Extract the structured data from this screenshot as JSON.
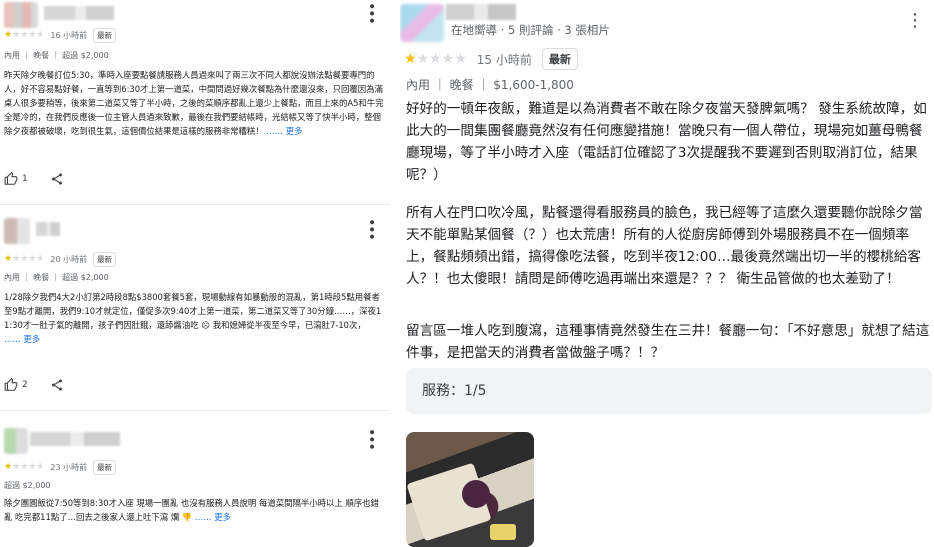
{
  "left_reviews": [
    {
      "time": "16 小時前",
      "badge": "最新",
      "sub": "內用 ｜ 晚餐 ｜ 超過 $2,000",
      "text": "昨天除夕晚餐訂位5:30，準時入座要點餐請服務人員過來叫了兩三次不同人都說沒辦法點餐要專門的人，好不容易點好餐，一直等到6:30才上第一道菜，中間問過好幾次餐點為什麼還沒來，只回覆因為滿桌人很多要稍等，後來第二道菜又等了半小時，之後的菜順序都亂上還少上餐點，而且上來的A5和牛完全是冷的，在我們反應後一位主管人員過來致歉，最後在我們要結帳時，光結帳又等了快半小時，整個除夕夜都被破壞，吃到很生氣，這個價位結果是這樣的服務非常糟糕！",
      "more": "…… 更多",
      "likes": "1"
    },
    {
      "time": "20 小時前",
      "badge": "最新",
      "sub": "內用 ｜ 晚餐 ｜ 超過 $2,000",
      "text": "1/28除夕我們4大2小訂第2時段8點$3800套餐5套，現場動線有如暴動般的混亂，第1時段5點用餐者至9點才離開，我們9:10才就定位，僅促多次9:40才上第一道菜，第二道菜又等了30分鐘……，深夜11:30才一肚子氣的離開，孩子們因肚餓，還舔醬油吃 ☹ 我和媳婦從半夜至今早，已瀉肚7-10次，",
      "more": "…… 更多",
      "likes": "2"
    },
    {
      "time": "23 小時前",
      "badge": "最新",
      "sub": "超過 $2,000",
      "text": "除夕團圓飯從7:50等到8:30才入座 現場一團亂 也沒有服務人員說明 每道菜間隔半小時以上 順序也錯亂 吃完都11點了…回去之後家人還上吐下瀉 爛 👎",
      "more": "…… 更多",
      "likes": ""
    }
  ],
  "right_review": {
    "guide": "在地嚮導 · 5 則評論 · 3 張相片",
    "time": "15 小時前",
    "badge": "最新",
    "sub": "內用 ｜ 晚餐 ｜ $1,600-1,800",
    "paragraphs": [
      "好好的一頓年夜飯，難道是以為消費者不敢在除夕夜當天發脾氣嗎？ 發生系統故障，如此大的一間集團餐廳竟然沒有任何應變措施！當晚只有一個人帶位，現場宛如薑母鴨餐廳現場，等了半小時才入座（電話訂位確認了3次提醒我不要遲到否則取消訂位，結果呢？）",
      "所有人在門口吹冷風，點餐還得看服務員的臉色，我已經等了這麼久還要聽你說除夕當天不能單點某個餐（？）也太荒唐！所有的人從廚房師傅到外場服務員不在一個頻率上，餐點頻頻出錯，搞得像吃法餐，吃到半夜12:00…最後竟然端出切一半的櫻桃給客人？！也太傻眼！請問是師傅吃過再端出來還是？？？ 衛生品管做的也太差勁了！",
      "留言區一堆人吃到腹瀉，這種事情竟然發生在三井！餐廳一句：「不好意思」就想了結這件事，是把當天的消費者當做盤子嗎？！？"
    ],
    "service": "服務：1/5"
  },
  "rating_stars": 1,
  "colors": {
    "star_on": "#fbbc04",
    "star_off": "#dadce0",
    "link": "#1a73e8"
  },
  "icons": [
    "more-vert-icon",
    "thumb-up-icon",
    "share-icon",
    "star-icon"
  ]
}
